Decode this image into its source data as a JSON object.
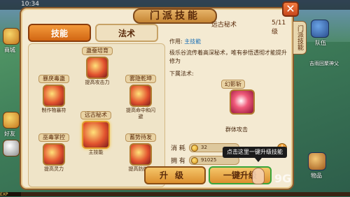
{
  "status": {
    "clock": "10:34"
  },
  "hud_left": {
    "shop_label": "商城",
    "friends_label": "好友"
  },
  "hud_right": {
    "team_label": "队伍",
    "items_label": "物品",
    "map_hint": "吉雨回聚神父"
  },
  "panel": {
    "title": "门派技能",
    "side_tab": "门派技能",
    "tabs": [
      {
        "label": "技能"
      },
      {
        "label": "法术"
      }
    ]
  },
  "skill_tree": {
    "nodes": [
      {
        "name": "蛊蚕培育",
        "effect": "提高攻击力"
      },
      {
        "name": "暴戾毒蛊",
        "effect": "制作物暴符"
      },
      {
        "name": "雾隐乾坤",
        "effect": "提高命中和闪避"
      },
      {
        "name": "远古秘术",
        "effect": "主技能"
      },
      {
        "name": "巫毒掌控",
        "effect": "提高灵力"
      },
      {
        "name": "蓄势待发",
        "effect": "提高防御力"
      }
    ]
  },
  "detail": {
    "title": "远古秘术",
    "level": "5/11级",
    "effect_label": "作用:",
    "effect_value": "主技能",
    "description": "极乐谷流传着高深秘术，唯有参悟透彻才能提升修为",
    "lower_spells_label": "下属法术:",
    "spell_name": "幻影斩",
    "spell_effect": "群体攻击"
  },
  "costs": {
    "consume_label": "消 耗",
    "consume_value": "32",
    "own_label": "拥 有",
    "own_value": "91025"
  },
  "buttons": {
    "upgrade": "升级",
    "one_click": "一键升级",
    "tooltip": "点击这里一键升级技能"
  },
  "watermark": "9G",
  "exp_label": "EXP",
  "colors": {
    "accent": "#d26613",
    "panel_bg": "#f4ead2",
    "border": "#8b5a2b",
    "link": "#1a6fb5"
  }
}
